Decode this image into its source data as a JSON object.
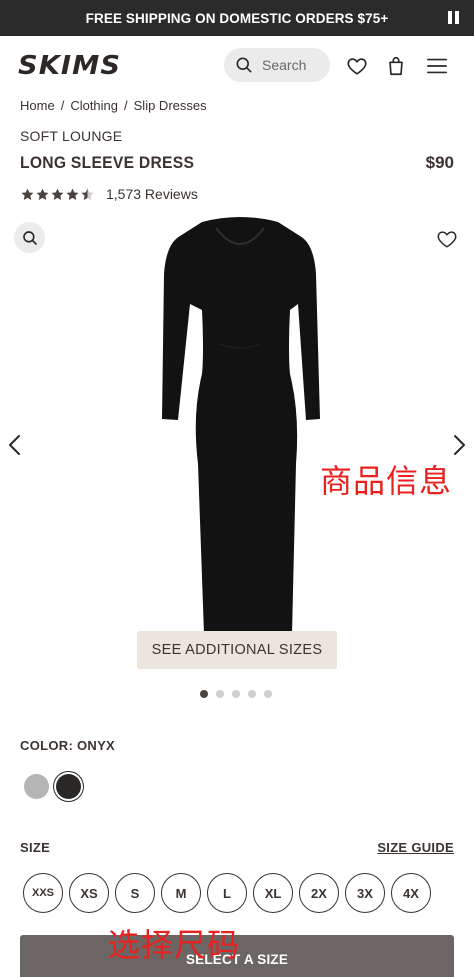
{
  "banner": {
    "text": "FREE SHIPPING ON DOMESTIC ORDERS $75+"
  },
  "header": {
    "logo": "SKIMS",
    "search_placeholder": "Search"
  },
  "breadcrumb": [
    "Home",
    "Clothing",
    "Slip Dresses"
  ],
  "product": {
    "collection": "SOFT LOUNGE",
    "name": "LONG SLEEVE DRESS",
    "price": "$90",
    "rating_value": 4.5,
    "rating_max": 5,
    "reviews": "1,573 Reviews"
  },
  "gallery": {
    "additional_sizes": "SEE ADDITIONAL SIZES",
    "slide_count": 5,
    "active_slide": 1,
    "annotation": "商品信息"
  },
  "color": {
    "label": "COLOR: ONYX",
    "swatches": [
      {
        "name": "grey",
        "hex": "#b5b5b5",
        "selected": false
      },
      {
        "name": "onyx",
        "hex": "#2a2827",
        "selected": true
      }
    ]
  },
  "size": {
    "label": "SIZE",
    "guide": "SIZE GUIDE",
    "options": [
      "XXS",
      "XS",
      "S",
      "M",
      "L",
      "XL",
      "2X",
      "3X",
      "4X"
    ],
    "annotation": "选择尺码"
  },
  "cta": {
    "label": "SELECT A SIZE"
  },
  "colors": {
    "text": "#3b3330",
    "banner": "#2b2b2b",
    "accent_annotation": "#e8201e",
    "cta": "#6b6563",
    "beige": "#ece5dc"
  }
}
